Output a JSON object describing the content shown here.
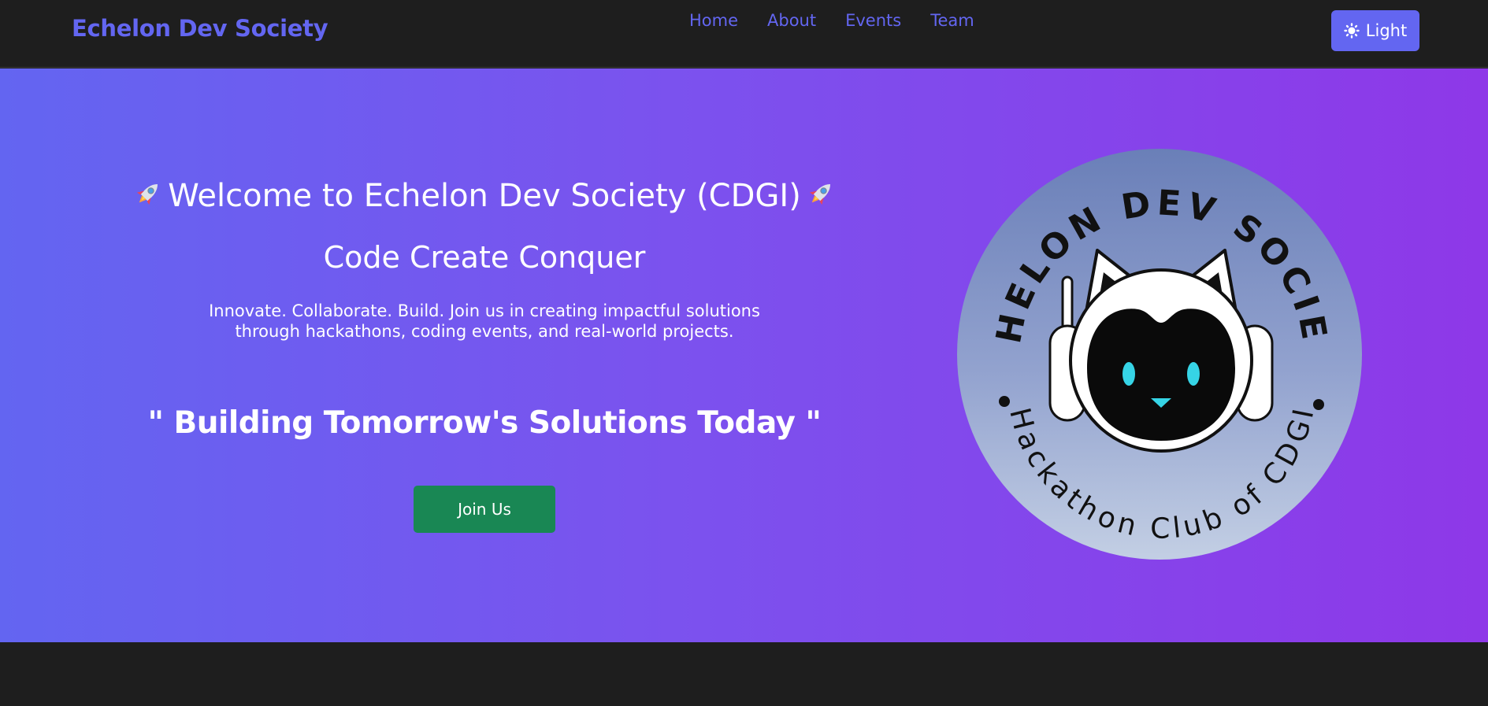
{
  "navbar": {
    "brand": "Echelon Dev Society",
    "links": [
      {
        "label": "Home"
      },
      {
        "label": "About"
      },
      {
        "label": "Events"
      },
      {
        "label": "Team"
      }
    ],
    "theme_toggle_label": "Light",
    "theme_toggle_icon": "sun-icon"
  },
  "hero": {
    "title": "Welcome to Echelon Dev Society (CDGI)",
    "title_icon": "rocket-icon",
    "subtitle": "Code Create Conquer",
    "description": "Innovate. Collaborate. Build. Join us in creating impactful solutions through hackathons, coding events, and real-world projects.",
    "quote": "\" Building Tomorrow's Solutions Today \"",
    "cta_label": "Join Us"
  },
  "logo": {
    "top_text": "ECHELON DEV SOCIETY",
    "bottom_text": "Hackathon Club of CDGI"
  },
  "colors": {
    "accent": "#6366f1",
    "gradient_start": "#6365f1",
    "gradient_end": "#8e38e8",
    "cta": "#198754",
    "navbar_bg": "#1e1e1e"
  }
}
